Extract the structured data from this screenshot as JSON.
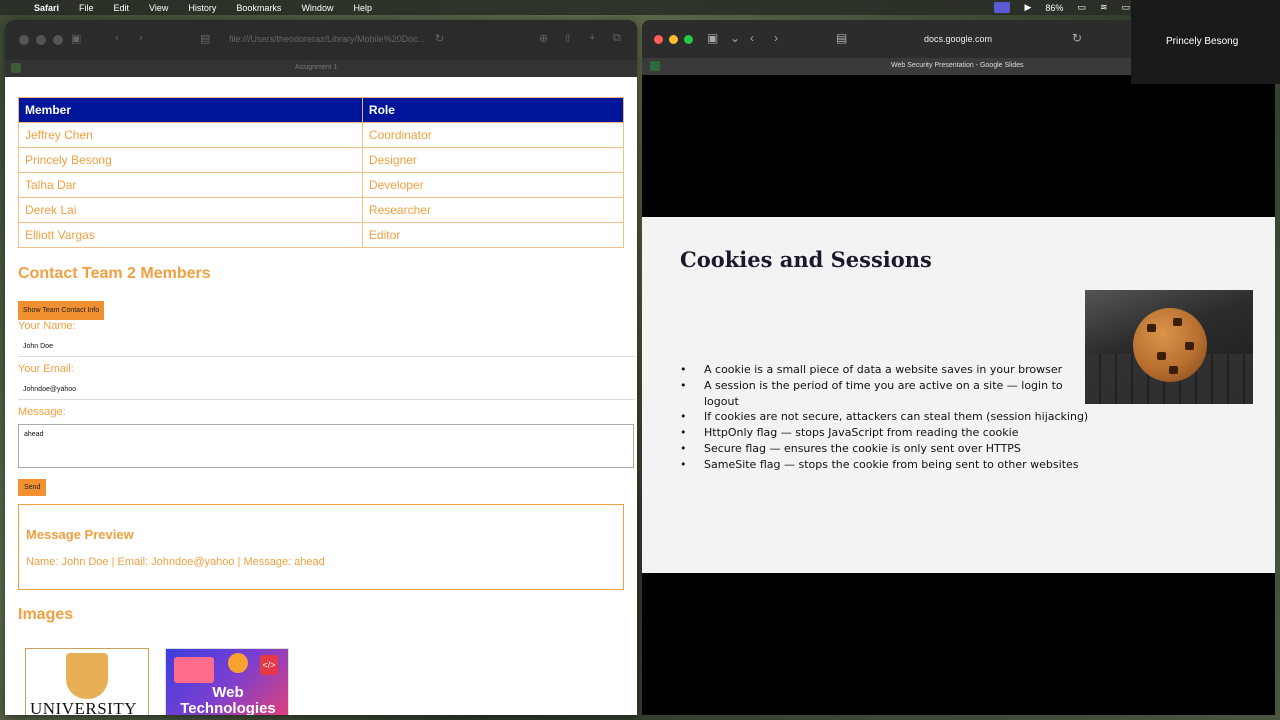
{
  "menubar": {
    "items": [
      "Safari",
      "File",
      "Edit",
      "View",
      "History",
      "Bookmarks",
      "Window",
      "Help"
    ],
    "battery": "86%"
  },
  "left_window": {
    "url": "file:///Users/theodoreraz/Library/Mobile%20Doc...",
    "tab_title": "Assignment 1",
    "table": {
      "headers": [
        "Member",
        "Role"
      ],
      "rows": [
        [
          "Jeffrey Chen",
          "Coordinator"
        ],
        [
          "Princely Besong",
          "Designer"
        ],
        [
          "Talha Dar",
          "Developer"
        ],
        [
          "Derek Lai",
          "Researcher"
        ],
        [
          "Elliott Vargas",
          "Editor"
        ]
      ]
    },
    "contact_heading": "Contact Team 2 Members",
    "show_contact_button": "Show Team Contact Info",
    "name_label": "Your Name:",
    "name_value": "John Doe",
    "email_label": "Your Email:",
    "email_value": "Johndoe@yahoo",
    "message_label": "Message:",
    "message_value": "ahead",
    "send_button": "Send",
    "preview_title": "Message Preview",
    "preview_text": "Name: John Doe | Email: Johndoe@yahoo | Message: ahead",
    "images_heading": "Images",
    "thumb_univ_text": "UNIVERSITY",
    "thumb_web_text_1": "Web",
    "thumb_web_text_2": "Technologies"
  },
  "right_window": {
    "url": "docs.google.com",
    "tab_title": "Web Security Presentation - Google Slides",
    "slide_title": "Cookies and Sessions",
    "bullets": [
      "A cookie is a small piece of data a website saves in your browser",
      "A session is the period of time you are active on a site — login to logout",
      "If cookies are not secure, attackers can steal them (session hijacking)",
      "HttpOnly flag — stops JavaScript from reading the cookie",
      "Secure flag — ensures the cookie is only sent over HTTPS",
      "SameSite flag — stops the cookie from being sent to other websites"
    ]
  },
  "participant_name": "Princely Besong"
}
